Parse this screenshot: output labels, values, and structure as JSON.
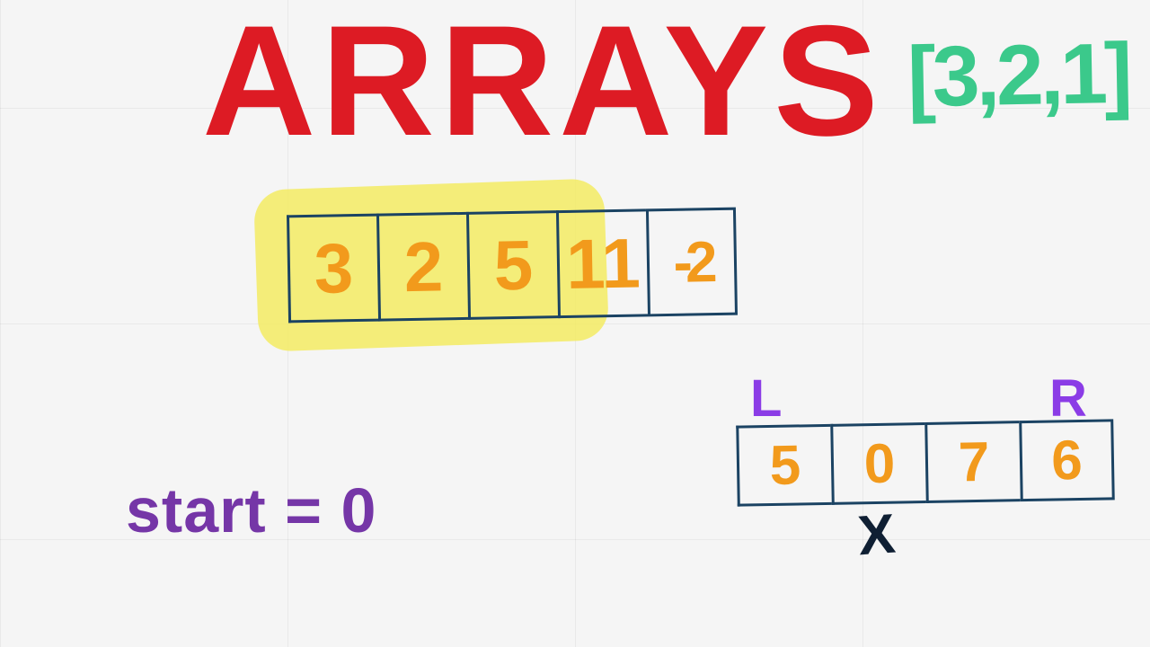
{
  "title": "ARRAYS",
  "literal": "[3,2,1]",
  "array1": [
    "3",
    "2",
    "5",
    "11",
    "-2"
  ],
  "array2": [
    "5",
    "0",
    "7",
    "6"
  ],
  "pointers": {
    "left": "L",
    "right": "R",
    "x": "X"
  },
  "start_label": "start = 0",
  "colors": {
    "title": "#dd1b24",
    "literal": "#3bc98b",
    "cell_border": "#1b4363",
    "cell_value": "#f29a1c",
    "highlight": "#f3eb63",
    "pointer": "#8b3ce6",
    "x_marker": "#0f1f33",
    "start": "#7536a7"
  }
}
